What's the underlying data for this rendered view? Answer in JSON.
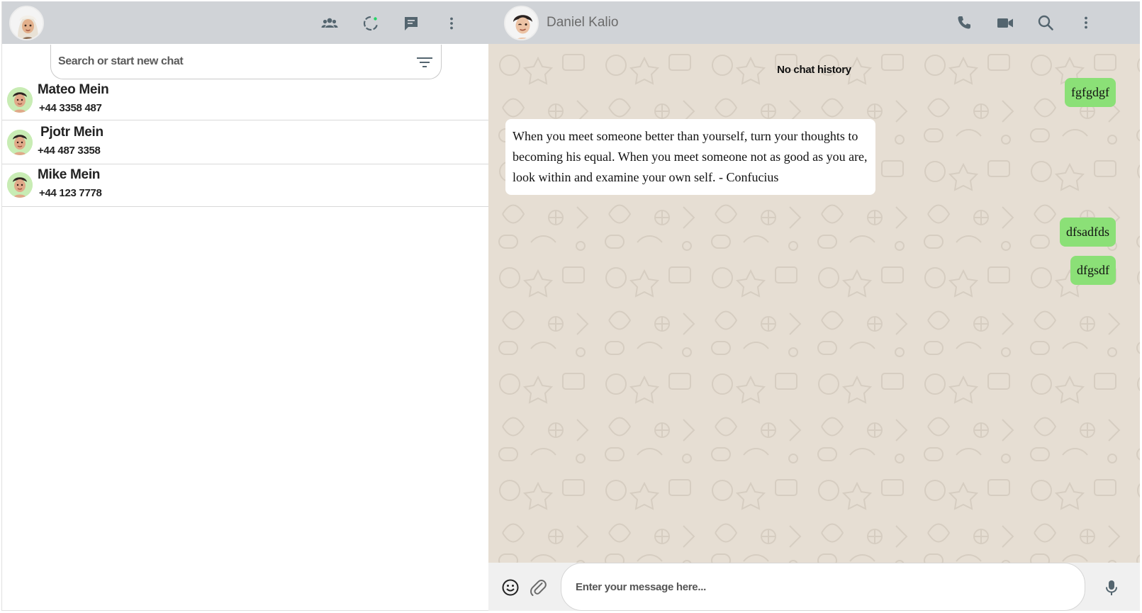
{
  "left_header": {
    "icons": [
      "community-icon",
      "status-icon",
      "new-chat-icon",
      "menu-icon"
    ]
  },
  "search": {
    "placeholder": "Search or start new chat"
  },
  "contacts": [
    {
      "name": "Mateo Mein",
      "phone": "+44 3358 487"
    },
    {
      "name": "Pjotr Mein",
      "phone": "+44 487 3358"
    },
    {
      "name": "Mike Mein",
      "phone": "+44 123 7778"
    }
  ],
  "chat": {
    "peer_name": "Daniel Kalio",
    "header_icons": [
      "phone-icon",
      "video-icon",
      "search-icon",
      "menu-icon"
    ],
    "no_history_label": "No chat history",
    "messages": [
      {
        "direction": "out",
        "text": "fgfgdgf"
      },
      {
        "direction": "in",
        "text": "When you meet someone better than yourself, turn your thoughts to becoming his equal. When you meet someone not as good as you are, look within and examine your own self. - Confucius"
      },
      {
        "direction": "out",
        "text": "dfsadfds"
      },
      {
        "direction": "out",
        "text": "dfgsdf"
      }
    ]
  },
  "composer": {
    "placeholder": "Enter your message here...",
    "icons": [
      "emoji-icon",
      "attach-icon",
      "mic-icon"
    ]
  },
  "colors": {
    "header_bg": "#d0d3d7",
    "outgoing_bubble": "#8be077",
    "incoming_bubble": "#ffffff",
    "chat_bg": "#e6ded3"
  }
}
